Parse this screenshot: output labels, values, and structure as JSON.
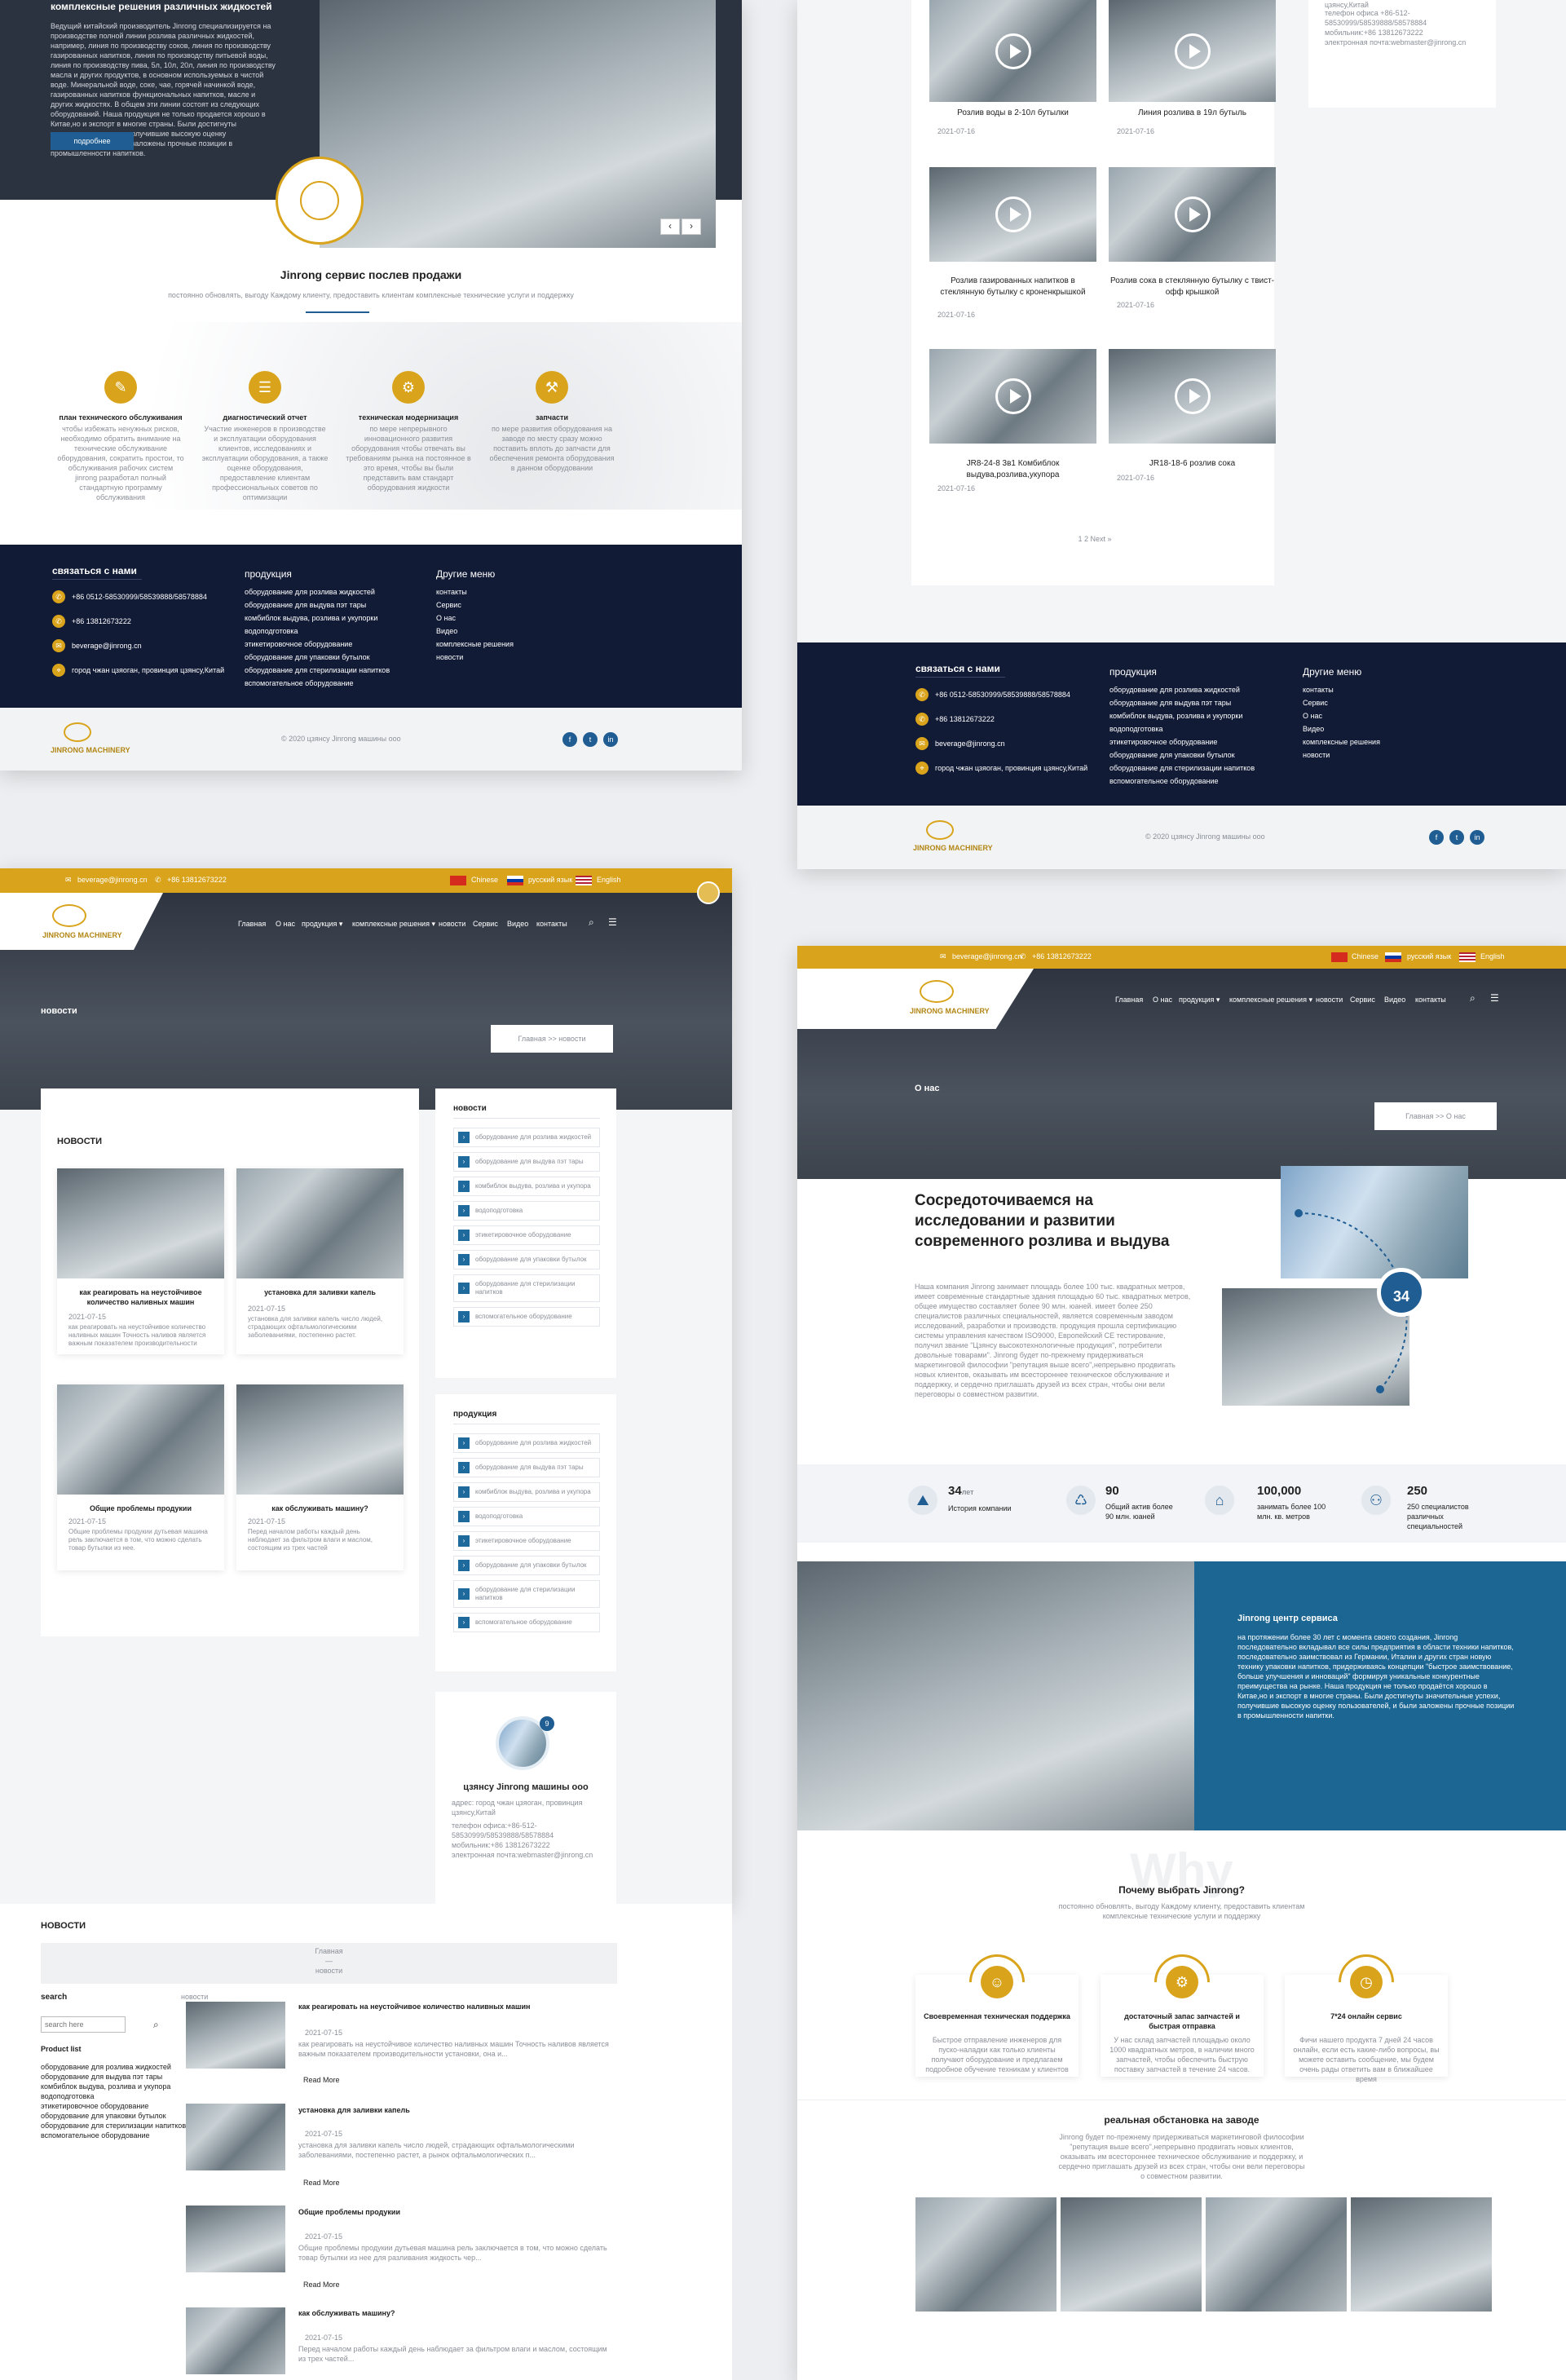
{
  "s1": {
    "hero_title": "комплексные решения различных жидкостей",
    "hero_text": "Ведущий китайский производитель Jinrong специализируется на производстве полной линии розлива различных жидкостей, например, линия по производству соков, линия по производству газированных напитков, линия по производству питьевой воды, линия по производству пива, 5л, 10л, 20л, линия по производству масла и других продуктов, в основном используемых в чистой воде. Минеральной воде, соке, чае, горячей начинкой воде, газированных напитков функциональных напитков, масле и других жидкостях. В общем эти линии состоят из следующих оборудований. Наша продукция не только продается хорошо в Китае,но и экспорт в многие страны. Были достигнуты значительные успехи, получившие высокую оценку пользователей, и были заложены прочные позиции в промышленности напитков.",
    "more_btn": "подробнее",
    "slider_prev": "‹",
    "slider_next": "›",
    "service_title": "Jinrong сервис послев продажи",
    "service_sub": "постоянно обновлять, выгоду Каждому клиенту, предоставить клиентам комплексные технические услуги и поддержку",
    "features": [
      {
        "icon": "calendar-icon",
        "glyph": "✎",
        "title": "план технического обслуживания",
        "text": "чтобы избежать ненужных рисков, необходимо обратить внимание на технические обслуживание оборудования, сократить простои, то обслуживания рабочих систем jinrong разработал полный стандартную программу обслуживания"
      },
      {
        "icon": "report-icon",
        "glyph": "☰",
        "title": "диагностический отчет",
        "text": "Участие инженеров в производстве и эксплуатации оборудования клиентов, исследованиях и эксплуатации оборудования, а также оценке оборудования, предоставление клиентам профессиональных советов по оптимизации"
      },
      {
        "icon": "gear-icon",
        "glyph": "⚙",
        "title": "техническая модернизация",
        "text": "по мере непрерывного инновационного развития оборудования чтобы отвечать вы требованиям рынка на постоянное в это время, чтобы вы были представить вам стандарт оборудования жидкости"
      },
      {
        "icon": "parts-icon",
        "glyph": "⚒",
        "title": "запчасти",
        "text": "по мере развития оборудования на заводе по месту сразу можно поставить вплоть до запчасти для обеспечения ремонта оборудования в данном оборудовании"
      }
    ]
  },
  "footer": {
    "contact_title": "связаться с нами",
    "phone1": "+86 0512-58530999/58539888/58578884",
    "phone2": "+86 13812673222",
    "email": "beverage@jinrong.cn",
    "address": "город чжан цзяоган, провинция цзянсу,Китай",
    "products_title": "продукция",
    "products": [
      "оборудование для розлива жидкостей",
      "оборудование для выдува пэт тары",
      "комбиблок выдува, розлива и укупорки",
      "водоподготовка",
      "этикетировочное оборудование",
      "оборудование для упаковки бутылок",
      "оборудование для стерилизации напитков",
      "вспомогательное оборудование"
    ],
    "menu_title": "Другие меню",
    "menu": [
      "контакты",
      "Сервис",
      "О нас",
      "Видео",
      "комплексные решения",
      "новости"
    ],
    "logo_text": "JINRONG MACHINERY",
    "copyright": "© 2020 цзянсу Jinrong машины ооо",
    "social": [
      "f",
      "t",
      "in"
    ]
  },
  "s2": {
    "contact_lines": [
      "цзянсу,Китай",
      "телефон офиса +86-512-",
      "58530999/58539888/58578884",
      "мобильник:+86 13812673222",
      "электронная почта:webmaster@jinrong.cn"
    ],
    "videos": [
      {
        "title": "Розлив воды в 2-10л бутылки",
        "date": "2021-07-16"
      },
      {
        "title": "Линия розлива в 19л бутыль",
        "date": "2021-07-16"
      },
      {
        "title": "Розлив газированных напитков в стеклянную бутылку с кроненкрышкой",
        "date": "2021-07-16"
      },
      {
        "title": "Розлив сока в стеклянную бутылку с твист-офф крышкой",
        "date": "2021-07-16"
      },
      {
        "title": "JR8-24-8 3в1 Комбиблок выдува,розлива,укупора",
        "date": "2021-07-16"
      },
      {
        "title": "JR18-18-6 розлив сока",
        "date": "2021-07-16"
      }
    ],
    "pagination": "1 2 Next »"
  },
  "topbar": {
    "email": "beverage@jinrong.cn",
    "phone": "+86 13812673222",
    "lang_cn": "Chinese",
    "lang_ru": "русский язык",
    "lang_en": "English"
  },
  "nav": {
    "items": [
      "Главная",
      "О нас",
      "продукция ▾",
      "комплексные решения ▾",
      "новости",
      "Сервис",
      "Видео",
      "контакты"
    ],
    "search_icon": "⌕",
    "menu_icon": "☰"
  },
  "s3": {
    "banner_title": "новости",
    "breadcrumb": "Главная >> новости",
    "list_title": "НОВОСТИ",
    "news": [
      {
        "title": "как реагировать на неустойчивое количество наливных машин",
        "date": "2021-07-15",
        "text": "как реагировать на неустойчивое количество наливных машин Точность наливов является важным показателем производительности установки."
      },
      {
        "title": "установка для заливки капель",
        "date": "2021-07-15",
        "text": "установка для заливки капель число людей, страдающих офтальмологическими заболеваниями, постепенно растет."
      },
      {
        "title": "Общие проблемы продукии",
        "date": "2021-07-15",
        "text": "Общие проблемы продукии дутьевая машина рель заключается в том, что можно сделать товар бутылки из нее."
      },
      {
        "title": "как обслуживать машину?",
        "date": "2021-07-15",
        "text": "Перед началом работы каждый день наблюдает за фильтром влаги и маслом, состоящим из трех частей"
      }
    ],
    "side_news_title": "новости",
    "side_products_title": "продукция",
    "side_items": [
      "оборудование для розлива жидкостей",
      "оборудование для выдува пэт тары",
      "комбиблок выдува, розлива и укупора",
      "водоподготовка",
      "этикетировочное оборудование",
      "оборудование для упаковки бутылок",
      "оборудование для стерилизации напитков",
      "вспомогательное оборудование"
    ],
    "company_badge": "9",
    "company_name": "цзянсу Jinrong машины ооо",
    "company_lines": [
      "адрес: город чжан цзяоган, провинция цзянсу,Китай",
      "телефон офиса:+86-512-",
      "58530999/58539888/58578884",
      "мобильник:+86 13812673222",
      "электронная почта:webmaster@jinrong.cn"
    ]
  },
  "s4": {
    "title": "НОВОСТИ",
    "crumb1": "Главная",
    "crumb_sep": "—",
    "crumb2": "новости",
    "search_label": "search",
    "search_placeholder": "search here",
    "search_icon": "⌕",
    "product_list_label": "Product list",
    "products": [
      "оборудование для розлива жидкостей",
      "оборудование для выдува пэт тары",
      "комбиблок выдува, розлива и укупора",
      "водоподготовка",
      "этикетировочное оборудование",
      "оборудование для упаковки бутылок",
      "оборудование для стерилизации напитков",
      "вспомогательное оборудование"
    ],
    "news_label": "новости",
    "read_more": "Read More",
    "items": [
      {
        "title": "как реагировать на неустойчивое количество наливных машин",
        "date": "2021-07-15",
        "text": "как реагировать на неустойчивое количество наливных машин Точность наливов является важным показателем производительности установки, она и..."
      },
      {
        "title": "установка для заливки капель",
        "date": "2021-07-15",
        "text": "установка для заливки капель число людей, страдающих офтальмологическими заболеваниями, постепенно растет, а рынок офтальмологических п..."
      },
      {
        "title": "Общие проблемы продукии",
        "date": "2021-07-15",
        "text": "Общие проблемы продукии дутьевая машина рель заключается в том, что можно сделать товар бутылки из нее для разливания жидкость чер..."
      },
      {
        "title": "как обслуживать машину?",
        "date": "2021-07-15",
        "text": "Перед началом работы каждый день наблюдает за фильтром влаги и маслом, состоящим из трех частей..."
      }
    ]
  },
  "s5": {
    "banner_title": "О нас",
    "breadcrumb": "Главная >> О нас",
    "headline": "Сосредоточиваемся на исследовании и развитии современного розлива и выдува",
    "body": "Наша компания Jinrong занимает площадь более 100 тыс. квадратных метров, имеет современные стандартные здания площадью 60 тыс. квадратных метров, общее имущество составляет более 90 млн. юаней. имеет более 250 специалистов различных специальностей, является современным заводом исследований, разработки и производств. продукция прошла сертификацию системы управления качеством ISO9000, Европейский CE тестирование, получил звание \"Цзянсу высокотехнологичные продукция\", потребители довольные товарами\". Jinrong будет по-прежнему придерживаться маркетинговой философии \"репутация выше всего\",непрерывно продвигать новых клиентов, оказывать им всестороннее техническое обслуживание и поддержку, и сердечно приглашать друзей из всех стран, чтобы они вели переговоры о совместном развитии.",
    "badge": "34",
    "stats": [
      {
        "icon": "history-icon",
        "glyph": "⛰",
        "num": "34",
        "unit": "лет",
        "label": "История компании"
      },
      {
        "icon": "assets-icon",
        "glyph": "♺",
        "num": "90",
        "unit": "",
        "label": "Общий актив более 90 млн. юаней"
      },
      {
        "icon": "area-icon",
        "glyph": "⌂",
        "num": "100,000",
        "unit": "",
        "label": "занимать более 100 млн. кв. метров"
      },
      {
        "icon": "staff-icon",
        "glyph": "⚇",
        "num": "250",
        "unit": "",
        "label": "250 специалистов различных специальностей"
      }
    ],
    "service_title": "Jinrong центр сервиса",
    "service_text": "на протяжении более 30 лет с момента своего создания, Jinrong последовательно вкладывал все силы предприятия в области техники напитков, последовательно заимствовал из Германии, Италии и других стран новую технику упаковки напитков, придерживаясь концепции \"быстрое заимствование, больше улучшения и инноваций\" формируя уникальные конкурентные преимущества на рынке. Наша продукция не только продаётся хорошо в Китае,но и экспорт в многие страны. Были достигнуты значительные успехи, получившие высокую оценку пользователей, и были заложены прочные позиции в промышленности напитки.",
    "why_bg": "Why",
    "why_title": "Почему выбрать Jinrong?",
    "why_sub": "постоянно обновлять, выгоду Каждому клиенту, предоставить клиентам комплексные технические услуги и поддержку",
    "why_cards": [
      {
        "icon": "engineer-icon",
        "glyph": "☺",
        "title": "Своевременная техническая поддержка",
        "text": "Быстрое отправление инженеров для пуско-наладки как только клиенты получают оборудование и предлагаем подробное обучение техникам у клиентов"
      },
      {
        "icon": "stock-icon",
        "glyph": "⚙",
        "title": "достаточный запас запчастей и быстрая отправка",
        "text": "У нас склад запчастей площадью около 1000 квадратных метров, в наличии много запчастей, чтобы обеспечить быструю поставку запчастей в течение 24 часов."
      },
      {
        "icon": "online-icon",
        "glyph": "◷",
        "title": "7*24 онлайн сервис",
        "text": "Фичи нашего продукта 7 дней 24 часов онлайн, если есть какие-либо вопросы, вы можете оставить сообщение, мы будем очень рады ответить вам в ближайшее время"
      }
    ],
    "factory_title": "реальная обстановка на заводе",
    "factory_text": "Jinrong будет по-прежнему придерживаться маркетинговой философии \"репутация выше всего\",непрерывно продвигать новых клиентов, оказывать им всестороннее техническое обслуживание и поддержку, и сердечно приглашать друзей из всех стран, чтобы они вели переговоры о совместном развитии."
  }
}
